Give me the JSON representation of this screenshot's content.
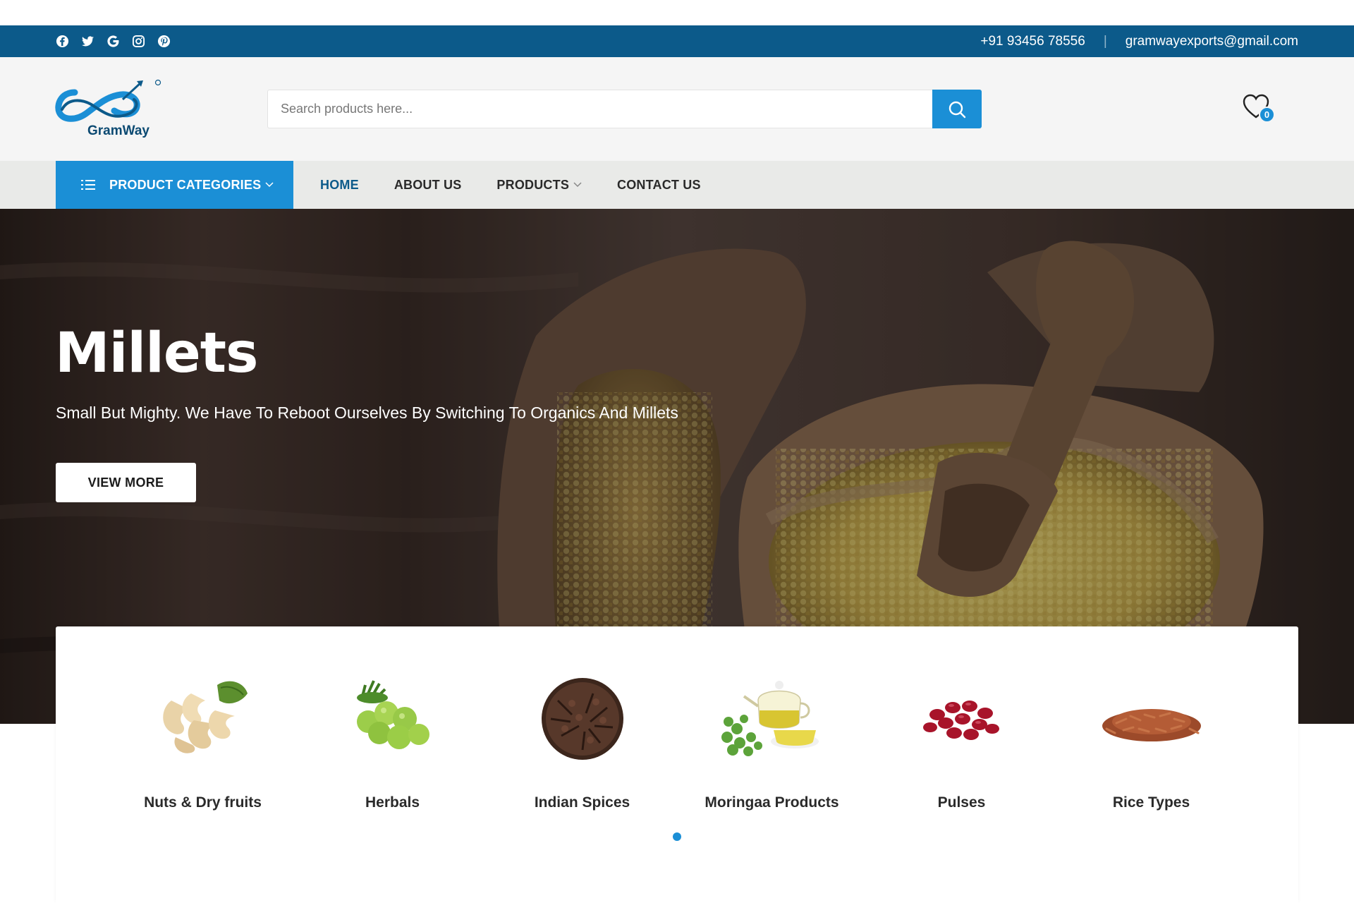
{
  "topbar": {
    "socials": [
      "facebook-icon",
      "twitter-icon",
      "google-icon",
      "instagram-icon",
      "pinterest-icon"
    ],
    "phone": "+91 93456 78556",
    "separator": "|",
    "email": "gramwayexports@gmail.com"
  },
  "header": {
    "logo_text": "GramWay",
    "search_placeholder": "Search products here...",
    "wishlist_count": "0"
  },
  "nav": {
    "categories_label": "PRODUCT CATEGORIES",
    "items": [
      {
        "label": "HOME",
        "active": true
      },
      {
        "label": "ABOUT US"
      },
      {
        "label": "PRODUCTS",
        "dropdown": true
      },
      {
        "label": "CONTACT US"
      }
    ]
  },
  "hero": {
    "title": "Millets",
    "subtitle": "Small But Mighty. We Have To Reboot Ourselves By Switching To Organics And Millets",
    "button": "VIEW MORE"
  },
  "categories": [
    {
      "label": "Nuts & Dry fruits",
      "icon": "cashew-image"
    },
    {
      "label": "Herbals",
      "icon": "amla-image"
    },
    {
      "label": "Indian Spices",
      "icon": "cloves-image"
    },
    {
      "label": "Moringaa Products",
      "icon": "moringa-tea-image"
    },
    {
      "label": "Pulses",
      "icon": "red-beans-image"
    },
    {
      "label": "Rice Types",
      "icon": "red-rice-image"
    }
  ],
  "colors": {
    "topbar": "#0c5a8a",
    "accent": "#1b8fd6",
    "header_bg": "#f5f5f5",
    "nav_bg": "#e9eae8"
  }
}
